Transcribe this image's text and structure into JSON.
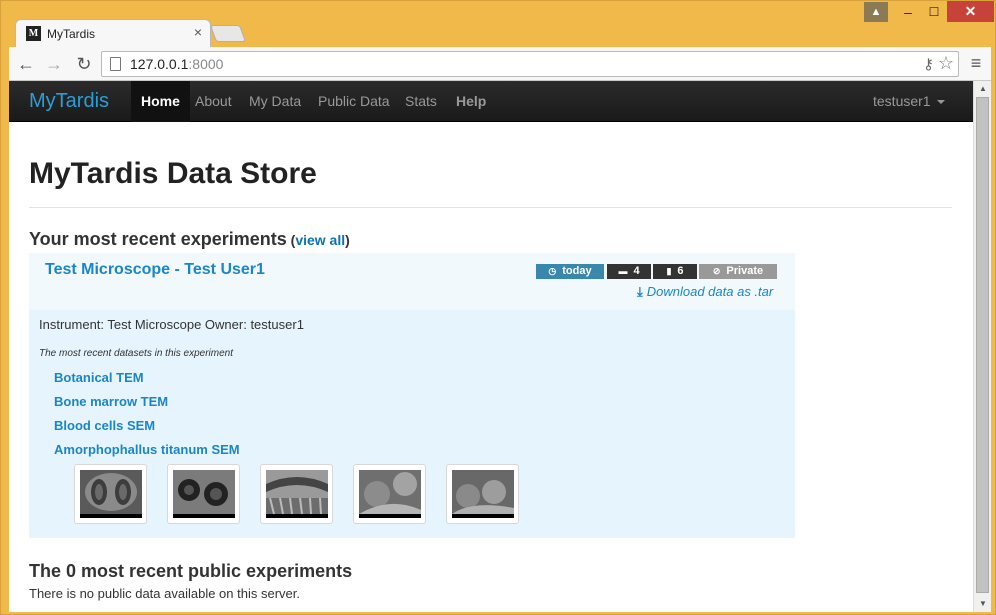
{
  "browser": {
    "tab_title": "MyTardis",
    "favicon_glyph": "M",
    "url_host": "127.0.0.1",
    "url_port": ":8000"
  },
  "navbar": {
    "brand": "MyTardis",
    "items": [
      {
        "label": "Home",
        "active": true
      },
      {
        "label": "About"
      },
      {
        "label": "My Data"
      },
      {
        "label": "Public Data"
      },
      {
        "label": "Stats"
      },
      {
        "label": "Help",
        "bold": true
      }
    ],
    "user": "testuser1"
  },
  "page": {
    "title": "MyTardis Data Store",
    "recent_heading": "Your most recent experiments",
    "view_all_open": " (",
    "view_all": "view all",
    "view_all_close": ")"
  },
  "experiment": {
    "title": "Test Microscope - Test User1",
    "badge_date": "today",
    "badge_datasets": "4",
    "badge_datafiles": "6",
    "badge_visibility": "Private",
    "download": "Download data as .tar",
    "info": "Instrument: Test Microscope Owner: testuser1",
    "datasets_label": "The most recent datasets in this experiment",
    "datasets": [
      "Botanical TEM",
      "Bone marrow TEM",
      "Blood cells SEM",
      "Amorphophallus titanum SEM"
    ],
    "thumbnails": [
      {
        "icon": "botanical-tem-thumbnail"
      },
      {
        "icon": "bone-marrow-tem-thumbnail"
      },
      {
        "icon": "tissue-sem-thumbnail"
      },
      {
        "icon": "blood-cells-sem-thumbnail"
      },
      {
        "icon": "blood-cells-sem-thumbnail-2"
      }
    ]
  },
  "public": {
    "heading": "The 0 most recent public experiments",
    "text": "There is no public data available on this server."
  },
  "colors": {
    "brand": "#2a9fd6",
    "link": "#1a86c8",
    "badge_today": "#3a87ad",
    "window_frame": "#f0b94a",
    "close_button": "#c7433a"
  }
}
